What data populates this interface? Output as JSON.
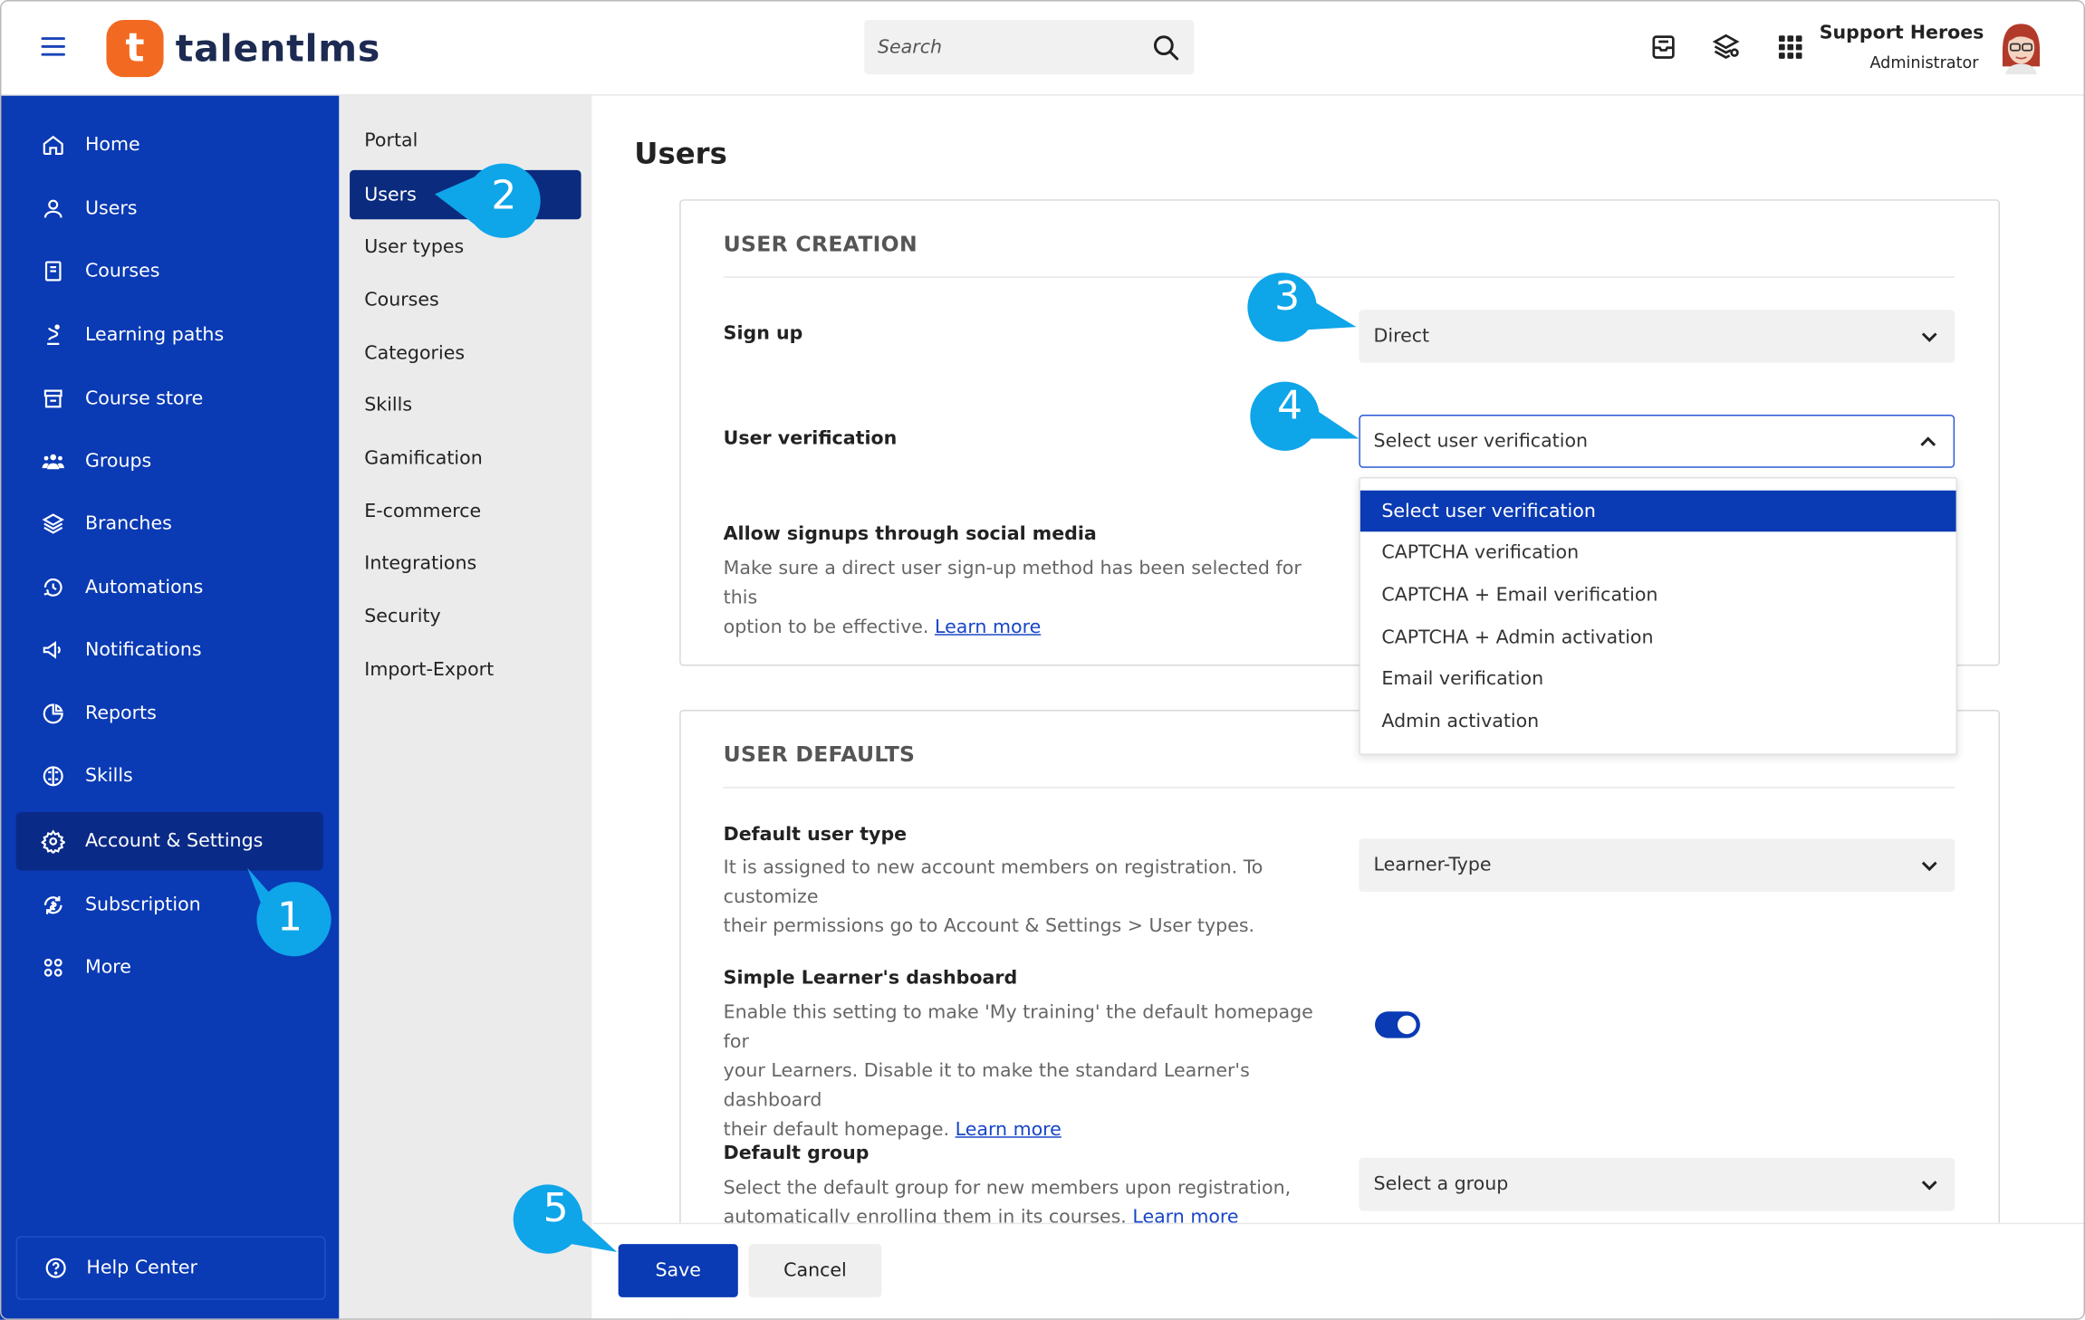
{
  "topbar": {
    "logo_letter": "t",
    "logo_text": "talentlms",
    "search_placeholder": "Search",
    "user_name": "Support Heroes",
    "user_role": "Administrator"
  },
  "sidebar": {
    "items": [
      {
        "label": "Home",
        "icon": "home-icon"
      },
      {
        "label": "Users",
        "icon": "user-icon"
      },
      {
        "label": "Courses",
        "icon": "book-icon"
      },
      {
        "label": "Learning paths",
        "icon": "path-icon"
      },
      {
        "label": "Course store",
        "icon": "store-icon"
      },
      {
        "label": "Groups",
        "icon": "groups-icon"
      },
      {
        "label": "Branches",
        "icon": "layers-icon"
      },
      {
        "label": "Automations",
        "icon": "automation-icon"
      },
      {
        "label": "Notifications",
        "icon": "megaphone-icon"
      },
      {
        "label": "Reports",
        "icon": "pie-chart-icon"
      },
      {
        "label": "Skills",
        "icon": "brain-icon"
      },
      {
        "label": "Account & Settings",
        "icon": "gear-icon",
        "active": true
      },
      {
        "label": "Subscription",
        "icon": "subscription-icon"
      },
      {
        "label": "More",
        "icon": "grid-icon"
      }
    ],
    "help_label": "Help Center"
  },
  "subsidebar": {
    "items": [
      "Portal",
      "Users",
      "User types",
      "Courses",
      "Categories",
      "Skills",
      "Gamification",
      "E-commerce",
      "Integrations",
      "Security",
      "Import-Export"
    ],
    "active": "Users"
  },
  "page": {
    "title": "Users",
    "user_creation": {
      "title": "USER CREATION",
      "signup_label": "Sign up",
      "signup_value": "Direct",
      "verification_label": "User verification",
      "verification_value": "Select user verification",
      "verification_options": [
        "Select user verification",
        "CAPTCHA verification",
        "CAPTCHA + Email verification",
        "CAPTCHA + Admin activation",
        "Email verification",
        "Admin activation"
      ],
      "social_label": "Allow signups through social media",
      "social_desc_1": "Make sure a direct user sign-up method has been selected for this",
      "social_desc_2": "option to be effective.",
      "learn_more": "Learn more"
    },
    "user_defaults": {
      "title": "USER DEFAULTS",
      "default_type_label": "Default user type",
      "default_type_desc_1": "It is assigned to new account members on registration. To customize",
      "default_type_desc_2": "their permissions go to Account & Settings > User types.",
      "default_type_value": "Learner-Type",
      "dashboard_label": "Simple Learner's dashboard",
      "dashboard_desc_1": "Enable this setting to make 'My training' the default homepage for",
      "dashboard_desc_2": "your Learners. Disable it to make the standard Learner's dashboard",
      "dashboard_desc_3": "their default homepage.",
      "dashboard_enabled": true,
      "group_label": "Default group",
      "group_desc_1": "Select the default group for new members upon registration,",
      "group_desc_2": "automatically enrolling them in its courses.",
      "group_value": "Select a group",
      "learn_more": "Learn more"
    },
    "save_label": "Save",
    "cancel_label": "Cancel"
  },
  "callouts": [
    "1",
    "2",
    "3",
    "4",
    "5"
  ],
  "colors": {
    "primary": "#0a3ab4",
    "primary_dark": "#0a2a88",
    "brand_orange": "#f26a21",
    "callout": "#0ea5e9"
  }
}
